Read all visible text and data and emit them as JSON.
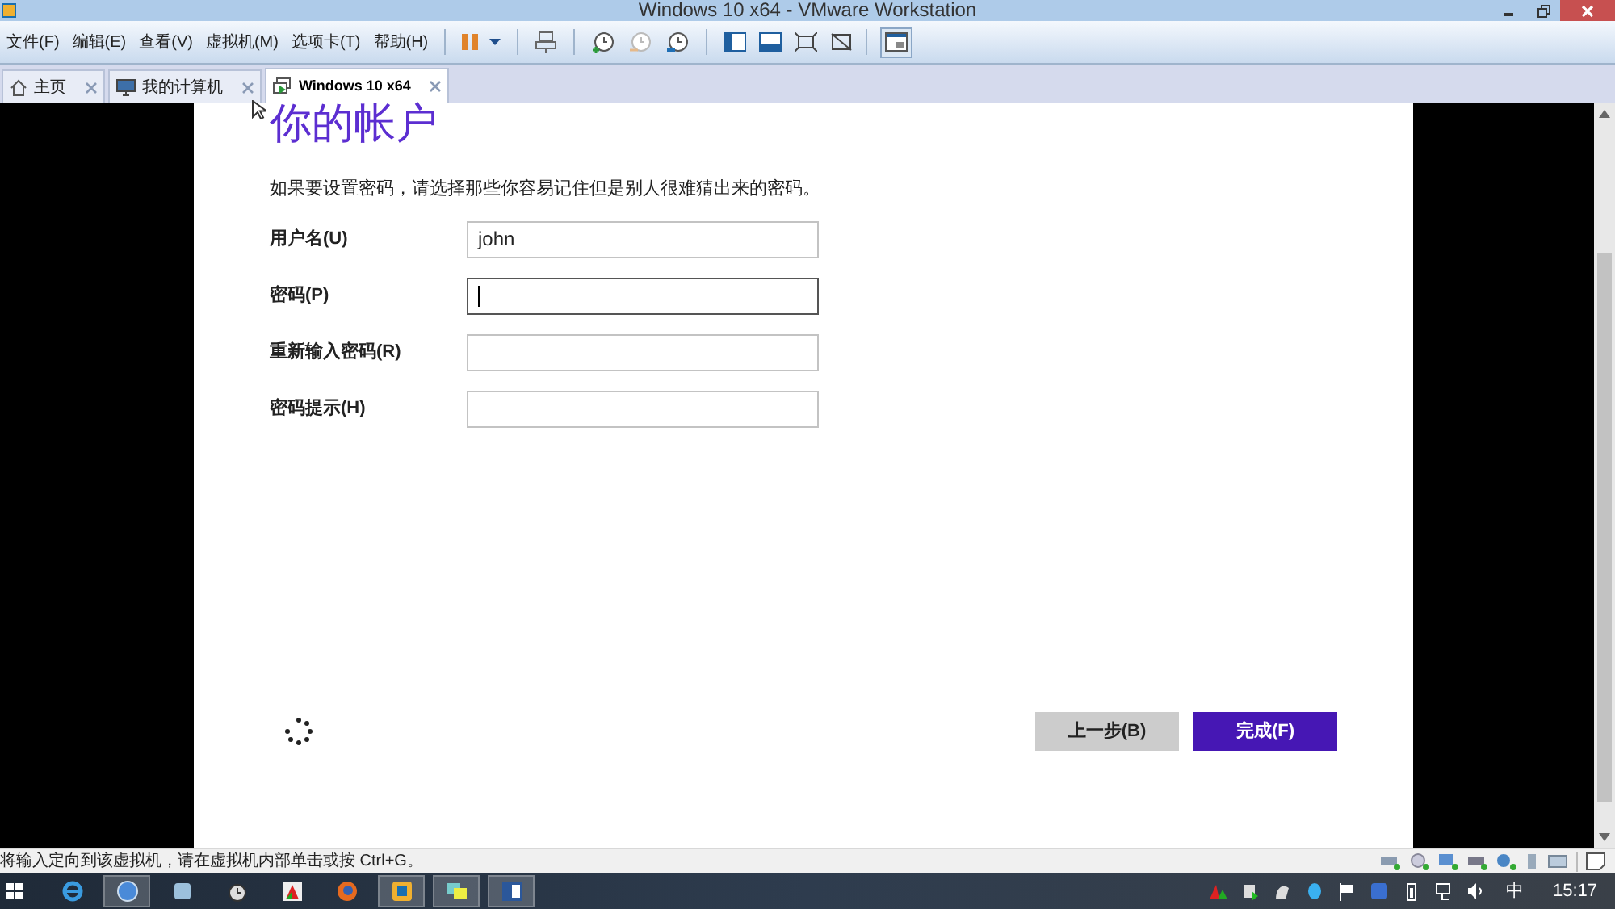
{
  "window": {
    "title": "Windows 10 x64 - VMware Workstation"
  },
  "menu": [
    "文件(F)",
    "编辑(E)",
    "查看(V)",
    "虚拟机(M)",
    "选项卡(T)",
    "帮助(H)"
  ],
  "tabs": [
    {
      "label": "主页",
      "kind": "home",
      "selected": false
    },
    {
      "label": "我的计算机",
      "kind": "computer",
      "selected": false
    },
    {
      "label": "Windows 10 x64",
      "kind": "vm",
      "selected": true
    }
  ],
  "setup": {
    "heading": "你的帐户",
    "intro": "如果要设置密码，请选择那些你容易记住但是别人很难猜出来的密码。",
    "fields": [
      {
        "label": "用户名(U)",
        "value": "john",
        "focused": false
      },
      {
        "label": "密码(P)",
        "focused": true
      },
      {
        "label": "重新输入密码(R)",
        "focused": false
      },
      {
        "label": "密码提示(H)",
        "focused": false
      }
    ],
    "buttons": [
      {
        "label": "上一步(B)",
        "kind": "secondary"
      },
      {
        "label": "完成(F)",
        "kind": "primary"
      }
    ]
  },
  "status_bar": {
    "text": "将输入定向到该虚拟机，请在虚拟机内部单击或按 Ctrl+G。"
  },
  "taskbar": {
    "apps": [
      {
        "kind": "ie",
        "active": false
      },
      {
        "kind": "globe",
        "active": true
      },
      {
        "kind": "disk",
        "active": false
      },
      {
        "kind": "clock",
        "active": false
      },
      {
        "kind": "chart",
        "active": false
      },
      {
        "kind": "firefox",
        "active": false
      },
      {
        "kind": "vmware",
        "active": true
      },
      {
        "kind": "chat",
        "active": true
      },
      {
        "kind": "word",
        "active": true
      }
    ],
    "ime": "中",
    "time": "15:17"
  }
}
